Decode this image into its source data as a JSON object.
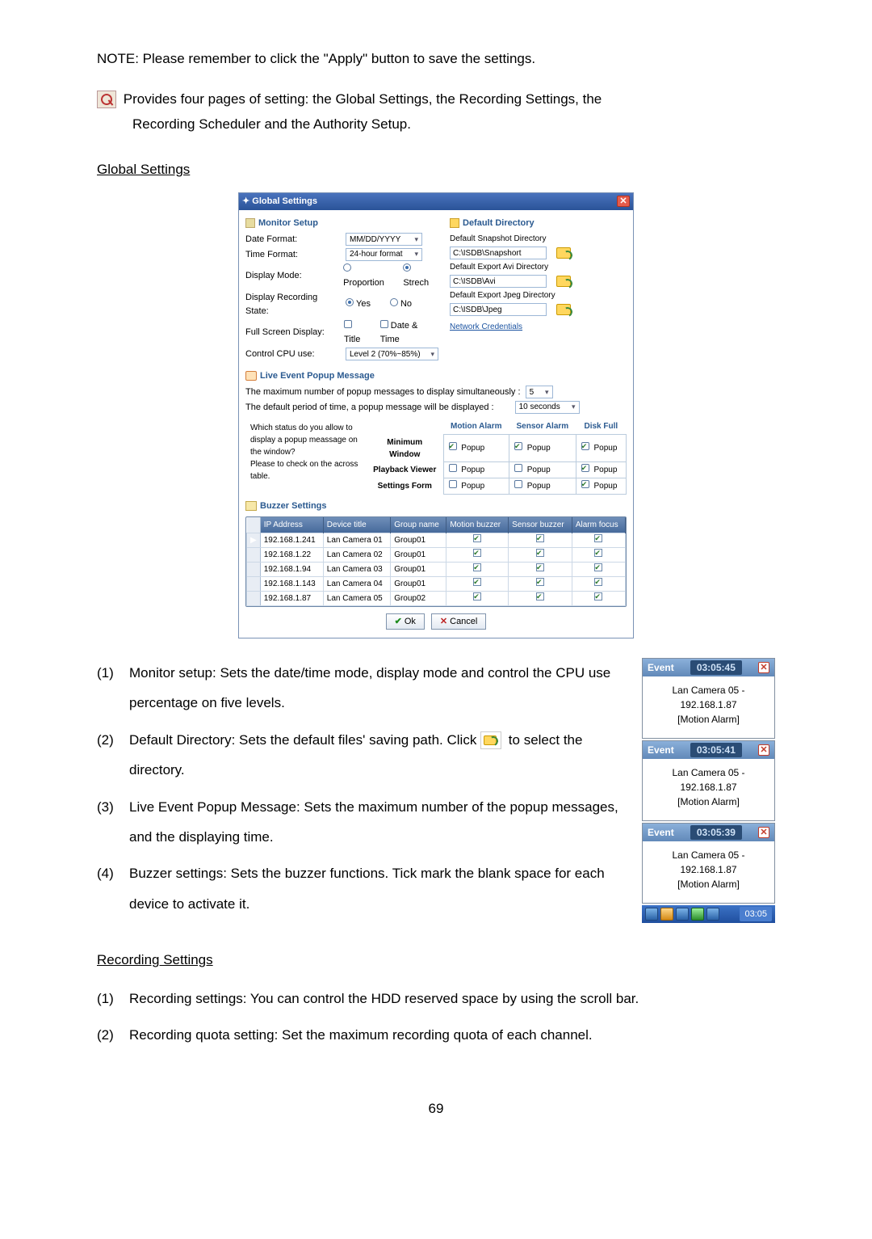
{
  "intro": {
    "note": "NOTE: Please remember to click the \"Apply\" button to save the settings.",
    "tool_line1": " Provides four pages of setting: the Global Settings, the Recording Settings, the",
    "tool_line2": "Recording Scheduler and the Authority Setup."
  },
  "sections": {
    "global_title": "Global Settings",
    "recording_title": "Recording Settings"
  },
  "dialog": {
    "title": "Global Settings",
    "monitor": {
      "hdr": "Monitor Setup",
      "date_format_lbl": "Date Format:",
      "date_format_val": "MM/DD/YYYY",
      "time_format_lbl": "Time Format:",
      "time_format_val": "24-hour format",
      "display_mode_lbl": "Display Mode:",
      "proportion": "Proportion",
      "strech": "Strech",
      "rec_state_lbl": "Display Recording State:",
      "yes": "Yes",
      "no": "No",
      "full_lbl": "Full Screen Display:",
      "titlechk": "Title",
      "dt": "Date & Time",
      "cpu_lbl": "Control CPU use:",
      "cpu_val": "Level 2 (70%~85%)"
    },
    "dirs": {
      "hdr": "Default Directory",
      "snap_lbl": "Default Snapshot Directory",
      "snap_val": "C:\\ISDB\\Snapshort",
      "avi_lbl": "Default Export Avi Directory",
      "avi_val": "C:\\ISDB\\Avi",
      "jpg_lbl": "Default Export Jpeg Directory",
      "jpg_val": "C:\\ISDB\\Jpeg",
      "netcred": "Network Credentials"
    },
    "live": {
      "hdr": "Live Event Popup Message",
      "max_lbl": "The maximum number of popup messages to display simultaneously :",
      "max_val": "5",
      "period_lbl": "The default period of time, a popup message will be displayed :",
      "period_val": "10 seconds",
      "left_q": "Which status do you allow to display a popup meassage on the window?\nPlease to check on the across table.",
      "cats": {
        "motion": "Motion Alarm",
        "sensor": "Sensor Alarm",
        "disk": "Disk Full"
      },
      "rows": {
        "min": "Minimum Window",
        "pb": "Playback Viewer",
        "set": "Settings Form"
      },
      "popup": "Popup"
    },
    "buzzer": {
      "hdr": "Buzzer Settings",
      "cols": {
        "ip": "IP Address",
        "dev": "Device title",
        "grp": "Group name",
        "mb": "Motion buzzer",
        "sb": "Sensor buzzer",
        "af": "Alarm focus"
      },
      "rows": [
        {
          "ip": "192.168.1.241",
          "dev": "Lan Camera 01",
          "grp": "Group01",
          "mb": true,
          "sb": true,
          "af": true,
          "ptr": true,
          "sel": true
        },
        {
          "ip": "192.168.1.22",
          "dev": "Lan Camera 02",
          "grp": "Group01",
          "mb": true,
          "sb": true,
          "af": true
        },
        {
          "ip": "192.168.1.94",
          "dev": "Lan Camera 03",
          "grp": "Group01",
          "mb": true,
          "sb": true,
          "af": true
        },
        {
          "ip": "192.168.1.143",
          "dev": "Lan Camera 04",
          "grp": "Group01",
          "mb": true,
          "sb": true,
          "af": true
        },
        {
          "ip": "192.168.1.87",
          "dev": "Lan Camera 05",
          "grp": "Group02",
          "mb": true,
          "sb": true,
          "af": true
        }
      ]
    },
    "buttons": {
      "ok": "Ok",
      "cancel": "Cancel"
    }
  },
  "list1": {
    "i1": "Monitor setup: Sets the date/time mode, display mode and control the CPU use percentage on five levels.",
    "i2a": "Default Directory: Sets the default files' saving path. Click ",
    "i2b": " to select the directory.",
    "i3": "Live Event Popup Message: Sets the maximum number of the popup messages, and the displaying time.",
    "i4": "Buzzer settings: Sets the buzzer functions. Tick mark the blank space for each device to activate it."
  },
  "popup": {
    "event": "Event",
    "times": [
      "03:05:45",
      "03:05:41",
      "03:05:39"
    ],
    "body1": "Lan Camera 05 - 192.168.1.87",
    "body2": "[Motion Alarm]",
    "clock": "03:05"
  },
  "list2": {
    "i1": "Recording settings: You can control the HDD reserved space by using the scroll bar.",
    "i2": "Recording quota setting: Set the maximum recording quota of each channel."
  },
  "page": "69"
}
